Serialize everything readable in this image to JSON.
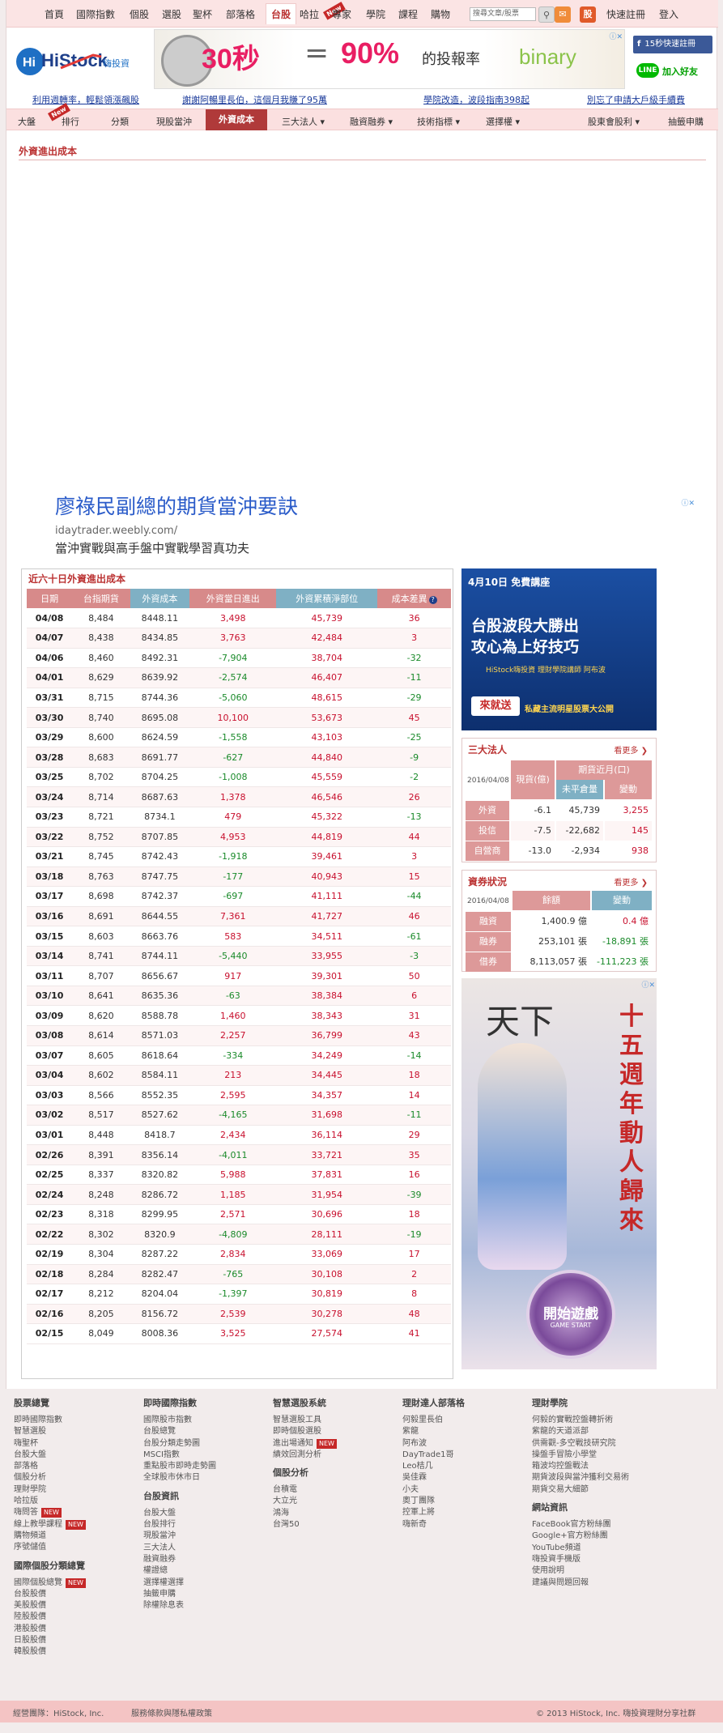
{
  "top_nav": {
    "items": [
      "首頁",
      "國際指數",
      "個股",
      "選股",
      "聖杯",
      "部落格",
      "台股",
      "哈拉",
      "專家",
      "學院",
      "課程",
      "購物"
    ],
    "new_tag": "New",
    "search_placeholder": "搜尋文章/股票",
    "share_icon_text": "股",
    "right_links": [
      "快速註冊",
      "登入"
    ]
  },
  "header": {
    "logo_text": "HiStock",
    "logo_sub": "嗨投資",
    "banner": {
      "big1": "30秒",
      "equals": "=",
      "big2": "90%",
      "text": "的投報率",
      "brand": "binary"
    },
    "fb_label": "15秒快速註冊",
    "line_label": "加入好友"
  },
  "sub_links": [
    "利用週轉率，輕鬆領漲飆股",
    "謝謝阿暢里長伯，這個月我賺了95萬",
    "學院改造，波段指南398起",
    "別忘了申請大戶級手續費"
  ],
  "sec_nav": [
    "大盤",
    "排行",
    "分類",
    "現股當沖",
    "外資成本",
    "三大法人 ▾",
    "融資融券 ▾",
    "技術指標 ▾",
    "選擇權 ▾",
    "股東會股利 ▾",
    "抽籤申購"
  ],
  "page_title": "外資進出成本",
  "ad": {
    "title": "廖祿民副總的期貨當沖要訣",
    "url": "idaytrader.weebly.com/",
    "text": "當沖實戰與高手盤中實戰學習真功夫"
  },
  "table": {
    "title": "近六十日外資進出成本",
    "headers": [
      "日期",
      "台指期貨",
      "外資成本",
      "外資當日進出",
      "外資累積淨部位",
      "成本差異"
    ],
    "rows": [
      [
        "04/08",
        "8,484",
        "8448.11",
        "3,498",
        "45,739",
        "36"
      ],
      [
        "04/07",
        "8,438",
        "8434.85",
        "3,763",
        "42,484",
        "3"
      ],
      [
        "04/06",
        "8,460",
        "8492.31",
        "-7,904",
        "38,704",
        "-32"
      ],
      [
        "04/01",
        "8,629",
        "8639.92",
        "-2,574",
        "46,407",
        "-11"
      ],
      [
        "03/31",
        "8,715",
        "8744.36",
        "-5,060",
        "48,615",
        "-29"
      ],
      [
        "03/30",
        "8,740",
        "8695.08",
        "10,100",
        "53,673",
        "45"
      ],
      [
        "03/29",
        "8,600",
        "8624.59",
        "-1,558",
        "43,103",
        "-25"
      ],
      [
        "03/28",
        "8,683",
        "8691.77",
        "-627",
        "44,840",
        "-9"
      ],
      [
        "03/25",
        "8,702",
        "8704.25",
        "-1,008",
        "45,559",
        "-2"
      ],
      [
        "03/24",
        "8,714",
        "8687.63",
        "1,378",
        "46,546",
        "26"
      ],
      [
        "03/23",
        "8,721",
        "8734.1",
        "479",
        "45,322",
        "-13"
      ],
      [
        "03/22",
        "8,752",
        "8707.85",
        "4,953",
        "44,819",
        "44"
      ],
      [
        "03/21",
        "8,745",
        "8742.43",
        "-1,918",
        "39,461",
        "3"
      ],
      [
        "03/18",
        "8,763",
        "8747.75",
        "-177",
        "40,943",
        "15"
      ],
      [
        "03/17",
        "8,698",
        "8742.37",
        "-697",
        "41,111",
        "-44"
      ],
      [
        "03/16",
        "8,691",
        "8644.55",
        "7,361",
        "41,727",
        "46"
      ],
      [
        "03/15",
        "8,603",
        "8663.76",
        "583",
        "34,511",
        "-61"
      ],
      [
        "03/14",
        "8,741",
        "8744.11",
        "-5,440",
        "33,955",
        "-3"
      ],
      [
        "03/11",
        "8,707",
        "8656.67",
        "917",
        "39,301",
        "50"
      ],
      [
        "03/10",
        "8,641",
        "8635.36",
        "-63",
        "38,384",
        "6"
      ],
      [
        "03/09",
        "8,620",
        "8588.78",
        "1,460",
        "38,343",
        "31"
      ],
      [
        "03/08",
        "8,614",
        "8571.03",
        "2,257",
        "36,799",
        "43"
      ],
      [
        "03/07",
        "8,605",
        "8618.64",
        "-334",
        "34,249",
        "-14"
      ],
      [
        "03/04",
        "8,602",
        "8584.11",
        "213",
        "34,445",
        "18"
      ],
      [
        "03/03",
        "8,566",
        "8552.35",
        "2,595",
        "34,357",
        "14"
      ],
      [
        "03/02",
        "8,517",
        "8527.62",
        "-4,165",
        "31,698",
        "-11"
      ],
      [
        "03/01",
        "8,448",
        "8418.7",
        "2,434",
        "36,114",
        "29"
      ],
      [
        "02/26",
        "8,391",
        "8356.14",
        "-4,011",
        "33,721",
        "35"
      ],
      [
        "02/25",
        "8,337",
        "8320.82",
        "5,988",
        "37,831",
        "16"
      ],
      [
        "02/24",
        "8,248",
        "8286.72",
        "1,185",
        "31,954",
        "-39"
      ],
      [
        "02/23",
        "8,318",
        "8299.95",
        "2,571",
        "30,696",
        "18"
      ],
      [
        "02/22",
        "8,302",
        "8320.9",
        "-4,809",
        "28,111",
        "-19"
      ],
      [
        "02/19",
        "8,304",
        "8287.22",
        "2,834",
        "33,069",
        "17"
      ],
      [
        "02/18",
        "8,284",
        "8282.47",
        "-765",
        "30,108",
        "2"
      ],
      [
        "02/17",
        "8,212",
        "8204.04",
        "-1,397",
        "30,819",
        "8"
      ],
      [
        "02/16",
        "8,205",
        "8156.72",
        "2,539",
        "30,278",
        "48"
      ],
      [
        "02/15",
        "8,049",
        "8008.36",
        "3,525",
        "27,574",
        "41"
      ]
    ]
  },
  "promo": {
    "date": "4月10日 免費講座",
    "line1": "台股波段大勝出",
    "line2": "攻心為上好技巧",
    "line3": "HiStock嗨投資 理財學院講師 阿布波",
    "btn": "來就送",
    "gift": "私藏主流明星股票大公開"
  },
  "institutional": {
    "title": "三大法人",
    "more": "看更多",
    "date": "2016/04/08",
    "col_spot": "現貨(億)",
    "col_fut": "期貨近月(口)",
    "col_oi": "未平倉量",
    "col_chg": "變動",
    "rows": [
      [
        "外資",
        "-6.1",
        "45,739",
        "3,255"
      ],
      [
        "投信",
        "-7.5",
        "-22,682",
        "145"
      ],
      [
        "自營商",
        "-13.0",
        "-2,934",
        "938"
      ]
    ]
  },
  "margin": {
    "title": "資券狀況",
    "more": "看更多",
    "date": "2016/04/08",
    "col_bal": "餘額",
    "col_chg": "變動",
    "rows": [
      [
        "融資",
        "1,400.9 億",
        "0.4 億"
      ],
      [
        "融券",
        "253,101 張",
        "-18,891 張"
      ],
      [
        "借券",
        "8,113,057 張",
        "-111,223 張"
      ]
    ]
  },
  "game_ad": {
    "title": "天下",
    "vertical": "十五週年動人歸來",
    "start": "開始遊戲",
    "start_en": "GAME START"
  },
  "footer": {
    "cols": [
      {
        "h": "股票總覽",
        "items": [
          "即時國際指數",
          "智慧選股",
          "嗨聖杯",
          "台股大盤",
          "部落格",
          "個股分析",
          "理財學院",
          "哈拉版",
          "嗨問答",
          "線上教學課程",
          "購物頻道",
          "序號儲值"
        ],
        "h2": "國際個股分類總覽",
        "items2": [
          "國際個股總覽",
          "台股股價",
          "美股股價",
          "陸股股價",
          "港股股價",
          "日股股價",
          "韓股股價"
        ]
      },
      {
        "h": "即時國際指數",
        "items": [
          "國際股市指數",
          "台股總覽",
          "台股分類走勢圖",
          "MSCI指數",
          "重點股市即時走勢圖",
          "全球股市休市日"
        ],
        "h2": "台股資訊",
        "items2": [
          "台股大盤",
          "台股排行",
          "現股當沖",
          "三大法人",
          "融資融券",
          "權證總",
          "選擇權選擇",
          "抽籤申購",
          "除權除息表"
        ]
      },
      {
        "h": "智慧選股系統",
        "items": [
          "智慧選股工具",
          "即時個股選股",
          "進出場通知",
          "績效回測分析"
        ],
        "h2": "個股分析",
        "items2": [
          "台積電",
          "大立光",
          "鴻海",
          "台灣50"
        ]
      },
      {
        "h": "理財達人部落格",
        "items": [
          "何毅里長伯",
          "紫龍",
          "阿布波",
          "DayTrade1哥",
          "Leo桔几",
          "吳佳霖",
          "小夫",
          "奧丁團隊",
          "控軍上將",
          "嗨新奇"
        ]
      },
      {
        "h": "理財學院",
        "items": [
          "何毅的實戰控盤轉折術",
          "紫龍的天道派部",
          "供需觀-多空戰技研究院",
          "操盤手冒險小學堂",
          "箱波均控盤戰法",
          "期貨波段與當沖獲利交易術",
          "期貨交易大細節"
        ],
        "h2": "網站資訊",
        "items2": [
          "FaceBook官方粉絲團",
          "Google+官方粉絲團",
          "YouTube頻道",
          "嗨投資手機版",
          "使用說明",
          "建議與問題回報"
        ]
      }
    ],
    "new_tag": "NEW"
  },
  "bottom": {
    "left": "經營團隊：HiStock, Inc.",
    "mid": "服務條款與隱私權政策",
    "right": "© 2013 HiStock, Inc. 嗨投資理財分享社群"
  }
}
